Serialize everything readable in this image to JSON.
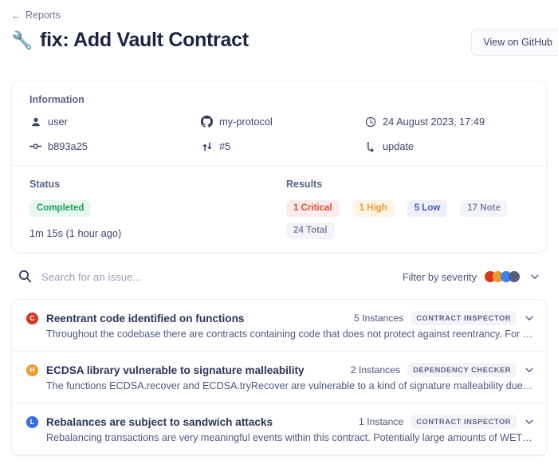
{
  "breadcrumb": {
    "back_icon": "arrow-left-icon",
    "label": "Reports"
  },
  "header": {
    "emoji": "🔧",
    "title": "fix: Add Vault Contract",
    "github_button": "View on GitHub"
  },
  "information": {
    "section_label": "Information",
    "items": [
      {
        "icon": "user-icon",
        "value": "user"
      },
      {
        "icon": "github-icon",
        "value": "my-protocol"
      },
      {
        "icon": "clock-icon",
        "value": "24 August 2023, 17:49"
      },
      {
        "icon": "commit-icon",
        "value": "b893a25"
      },
      {
        "icon": "pull-request-icon",
        "value": "#5"
      },
      {
        "icon": "branch-icon",
        "value": "update"
      }
    ]
  },
  "status": {
    "section_label": "Status",
    "badge": "Completed",
    "badge_color": "#19a05c",
    "duration": "1m 15s (1 hour ago)"
  },
  "results": {
    "section_label": "Results",
    "badges": [
      {
        "label": "1 Critical",
        "severity": "critical",
        "color": "#df4b3b"
      },
      {
        "label": "1 High",
        "severity": "high",
        "color": "#f0992c"
      },
      {
        "label": "5 Low",
        "severity": "low",
        "color": "#4d5bbd"
      },
      {
        "label": "17 Note",
        "severity": "note",
        "color": "#8089a8"
      },
      {
        "label": "24 Total",
        "severity": "total",
        "color": "#8089a8"
      }
    ]
  },
  "search": {
    "icon": "search-icon",
    "placeholder": "Search for an issue...",
    "value": ""
  },
  "filter": {
    "label": "Filter by severity",
    "dots": [
      "#d8371f",
      "#f0992c",
      "#3b82ef",
      "#575f7e"
    ],
    "chevron_icon": "chevron-down-icon"
  },
  "issues": [
    {
      "severity_letter": "C",
      "severity": "critical",
      "title": "Reentrant code identified on functions",
      "description": "Throughout the codebase there are contracts containing code that does not protect against reentrancy. For instance:",
      "instances": "5 Instances",
      "tool": "CONTRACT INSPECTOR"
    },
    {
      "severity_letter": "H",
      "severity": "high",
      "title": "ECDSA library vulnerable to signature malleability",
      "description": "The functions ECDSA.recover and ECDSA.tryRecover are vulnerable to a kind of signature malleability due to accepting El…",
      "instances": "2 Instances",
      "tool": "DEPENDENCY CHECKER"
    },
    {
      "severity_letter": "L",
      "severity": "low",
      "title": "Rebalances are subject to sandwich attacks",
      "description": "Rebalancing transactions are very meaningful events within this contract. Potentially large amounts of WETH and other to…",
      "instances": "1 Instance",
      "tool": "CONTRACT INSPECTOR"
    }
  ]
}
